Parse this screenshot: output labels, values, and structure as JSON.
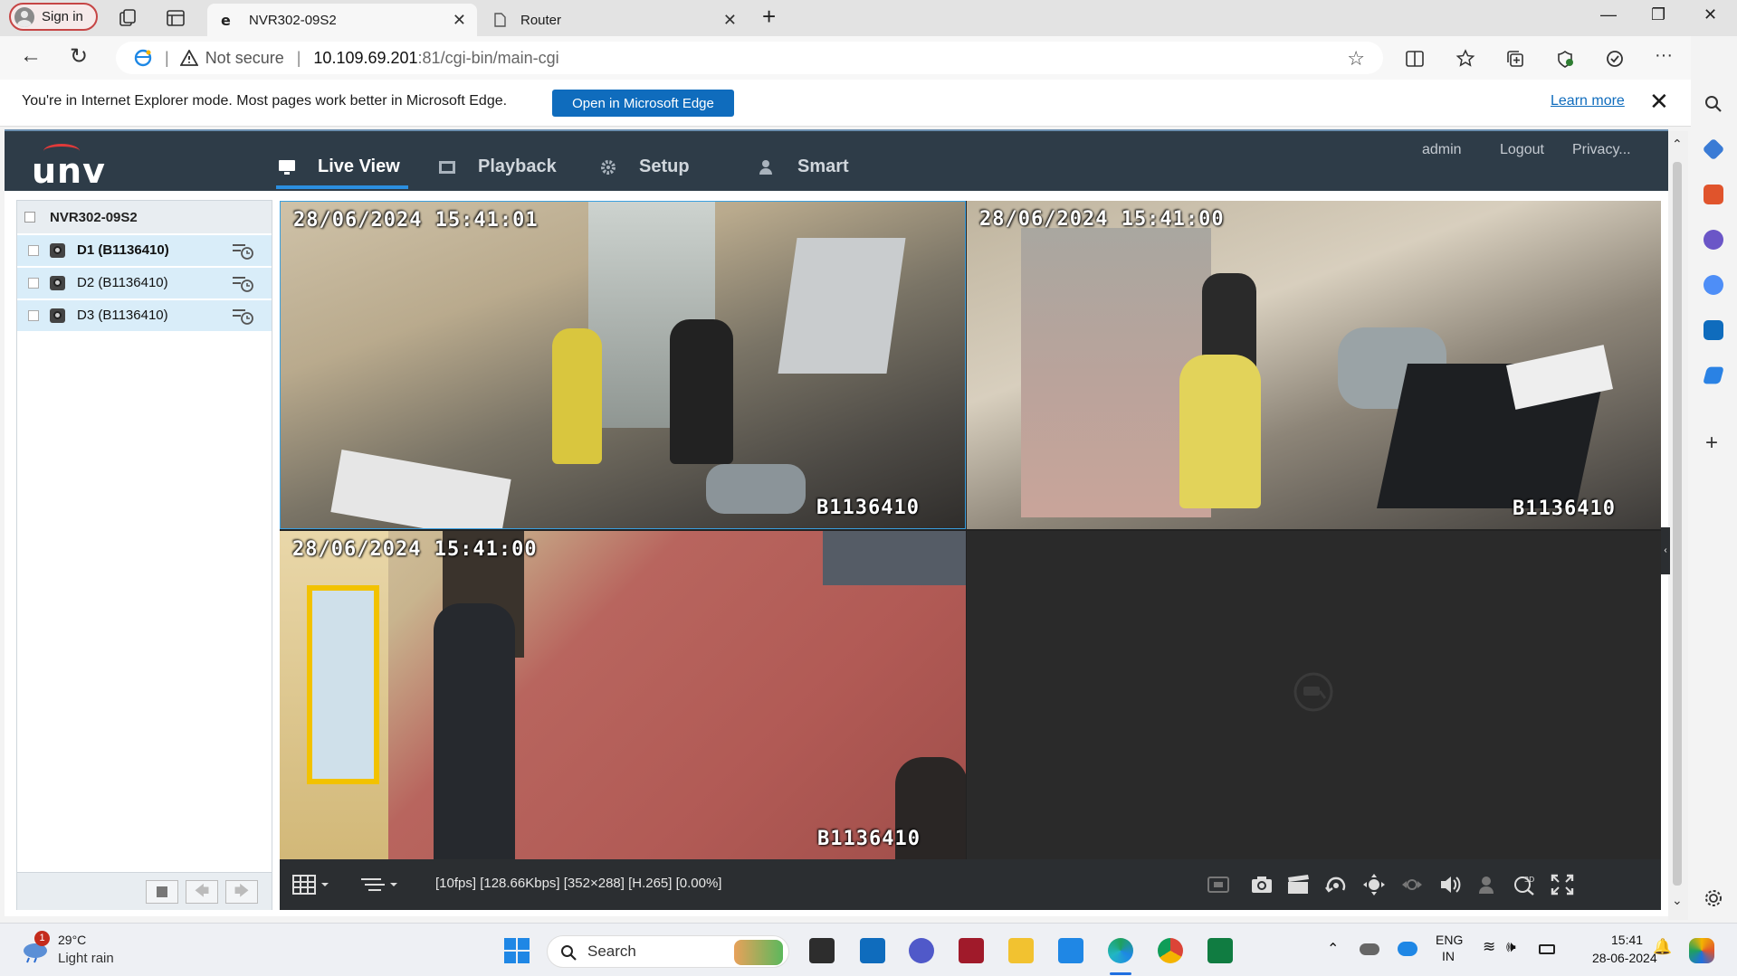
{
  "browser": {
    "signin_label": "Sign in",
    "tabs": [
      {
        "title": "NVR302-09S2",
        "active": true
      },
      {
        "title": "Router",
        "active": false
      }
    ],
    "new_tab": "+",
    "minimize": "—",
    "maximize": "❐",
    "close": "✕"
  },
  "address": {
    "security": "Not secure",
    "separator": "|",
    "url_host": "10.109.69.201",
    "url_rest": ":81/cgi-bin/main-cgi"
  },
  "ie_banner": {
    "message": "You're in Internet Explorer mode. Most pages work better in Microsoft Edge.",
    "open_button": "Open in Microsoft Edge",
    "learn_more": "Learn more"
  },
  "nvr": {
    "logo": "unv",
    "nav": [
      {
        "label": "Live View",
        "icon": "monitor-icon",
        "active": true
      },
      {
        "label": "Playback",
        "icon": "film-icon",
        "active": false
      },
      {
        "label": "Setup",
        "icon": "gear-icon",
        "active": false
      },
      {
        "label": "Smart",
        "icon": "person-icon",
        "active": false
      }
    ],
    "header_links": {
      "user": "admin",
      "logout": "Logout",
      "privacy": "Privacy..."
    },
    "device": "NVR302-09S2",
    "channels": [
      {
        "label": "D1 (B1136410)",
        "bold": true
      },
      {
        "label": "D2 (B1136410)",
        "bold": false
      },
      {
        "label": "D3 (B1136410)",
        "bold": false
      }
    ],
    "feeds": [
      {
        "timestamp": "28/06/2024  15:41:01",
        "camera_id": "B1136410"
      },
      {
        "timestamp": "28/06/2024  15:41:00",
        "camera_id": "B1136410"
      },
      {
        "timestamp": "28/06/2024  15:41:00",
        "camera_id": "B1136410"
      }
    ],
    "stream_stats": "[10fps] [128.66Kbps] [352×288] [H.265] [0.00%]"
  },
  "taskbar": {
    "weather_temp": "29°C",
    "weather_desc": "Light rain",
    "weather_badge": "1",
    "search": "Search",
    "lang_top": "ENG",
    "lang_bottom": "IN",
    "time": "15:41",
    "date": "28-06-2024"
  },
  "colors": {
    "nvr_header": "#2e3c48",
    "accent_blue": "#2b8fe0",
    "edge_blue": "#0f6cbd",
    "channel_highlight": "#d9edf9"
  }
}
